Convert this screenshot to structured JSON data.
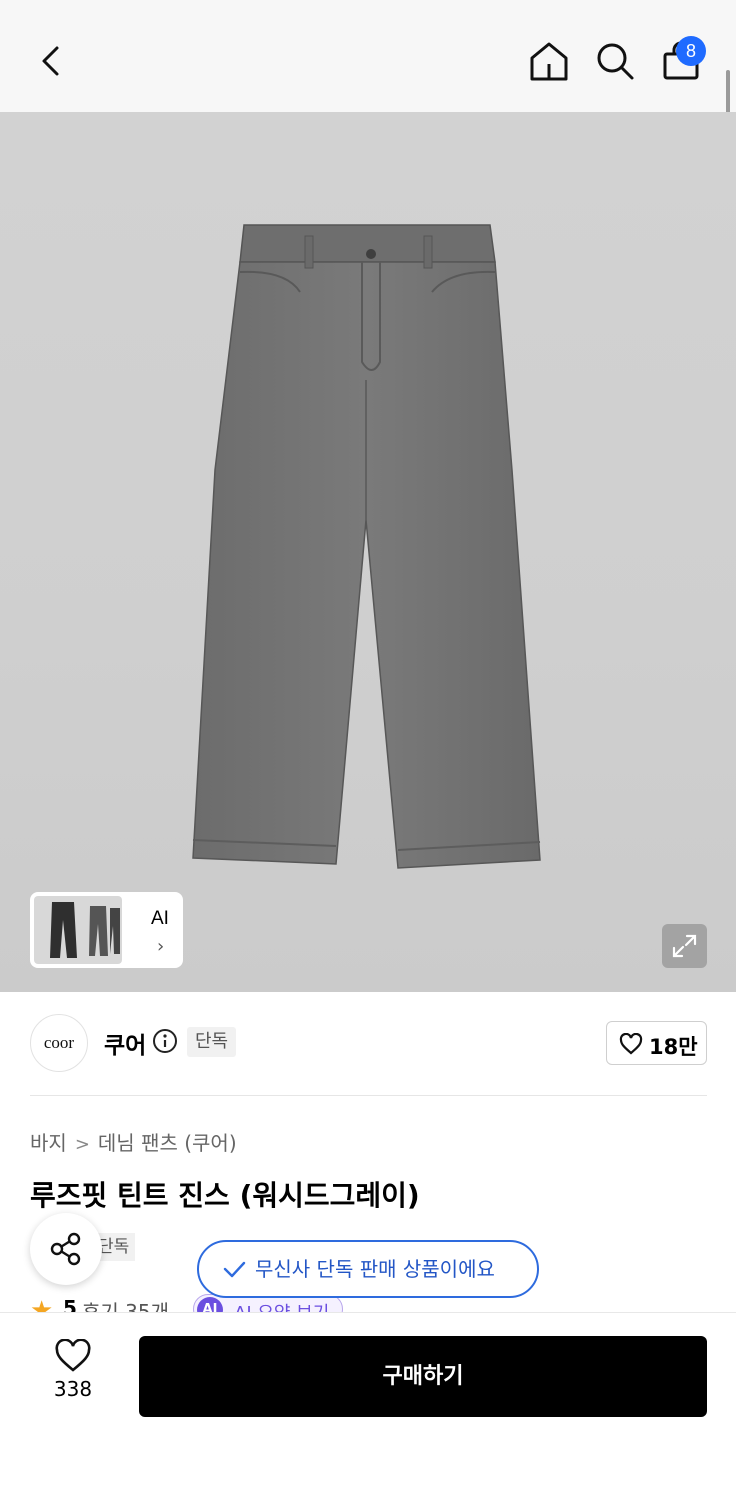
{
  "header": {
    "cart_count": "8",
    "badge_color": "#1f6bff"
  },
  "gallery": {
    "ai_label": "AI",
    "icons": [
      "expand-icon",
      "chevron-right-icon"
    ]
  },
  "brand": {
    "logo_text": "coor",
    "name": "쿠어",
    "tag": "단독",
    "likes": "18만"
  },
  "breadcrumb": [
    "바지",
    "데님 팬츠 (쿠어)"
  ],
  "product": {
    "title": "루즈핏 틴트 진스 (워시드그레이)",
    "tag": "단독",
    "rating": "5",
    "reviews": "후기 35개",
    "ai_badge": "AI",
    "ai_summary": "AI 요약 보기"
  },
  "toast": {
    "text": "무신사 단독 판매 상품이에요",
    "color": "#2e6bde"
  },
  "bottom_bar": {
    "wish_count": "338",
    "buy_label": "구매하기"
  }
}
